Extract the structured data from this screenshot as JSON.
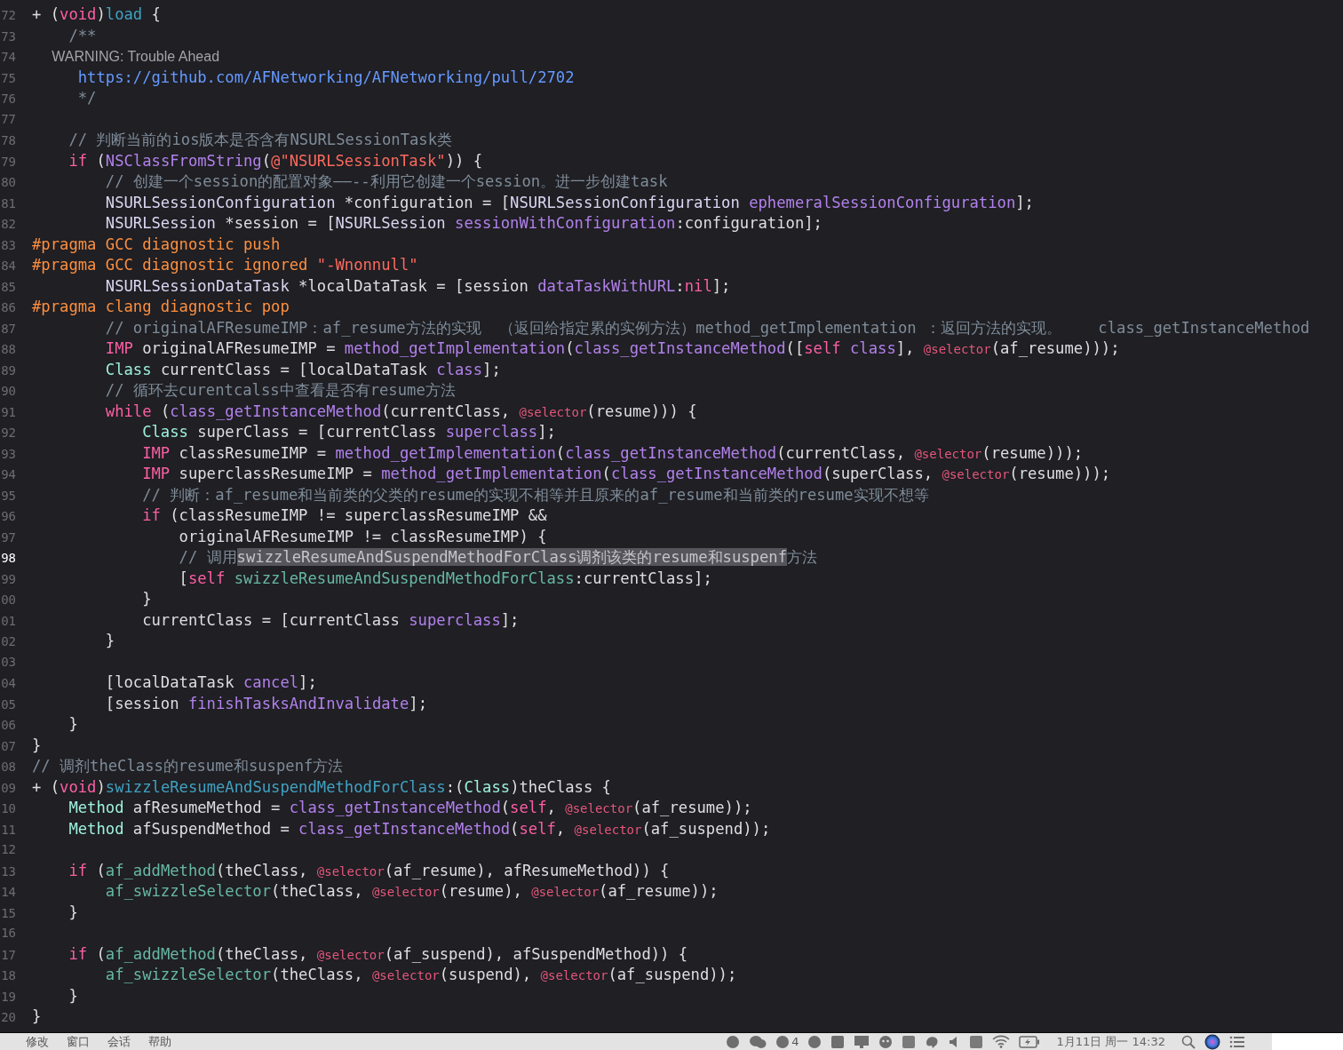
{
  "editor": {
    "lines": [
      {
        "number": "72",
        "current": false,
        "tokens": [
          {
            "kind": "plain",
            "text": "+ ("
          },
          {
            "kind": "keyword",
            "text": "void"
          },
          {
            "kind": "plain",
            "text": ")"
          },
          {
            "kind": "decl",
            "text": "load"
          },
          {
            "kind": "plain",
            "text": " {"
          }
        ]
      },
      {
        "number": "73",
        "current": false,
        "tokens": [
          {
            "kind": "comment",
            "text": "    /**"
          }
        ]
      },
      {
        "number": "74",
        "current": false,
        "tokens": [
          {
            "kind": "doc",
            "text": "     WARNING: Trouble Ahead"
          }
        ]
      },
      {
        "number": "75",
        "current": false,
        "tokens": [
          {
            "kind": "url",
            "text": "     https://github.com/AFNetworking/AFNetworking/pull/2702"
          }
        ]
      },
      {
        "number": "76",
        "current": false,
        "tokens": [
          {
            "kind": "comment",
            "text": "     */"
          }
        ]
      },
      {
        "number": "77",
        "current": false
      },
      {
        "number": "78",
        "current": false,
        "tokens": [
          {
            "kind": "comment",
            "text": "    // 判断当前的ios版本是否含有NSURLSessionTask类"
          }
        ]
      },
      {
        "number": "79",
        "current": false,
        "tokens": [
          {
            "kind": "keyword",
            "text": "    if"
          },
          {
            "kind": "plain",
            "text": " ("
          },
          {
            "kind": "lib",
            "text": "NSClassFromString"
          },
          {
            "kind": "plain",
            "text": "("
          },
          {
            "kind": "string",
            "text": "@\"NSURLSessionTask\""
          },
          {
            "kind": "plain",
            "text": ")) {"
          }
        ]
      },
      {
        "number": "80",
        "current": false,
        "tokens": [
          {
            "kind": "comment",
            "text": "        // 创建一个session的配置对象——--利用它创建一个session。进一步创建task"
          }
        ]
      },
      {
        "number": "81",
        "current": false,
        "tokens": [
          {
            "kind": "class",
            "text": "        NSURLSessionConfiguration"
          },
          {
            "kind": "plain",
            "text": " *configuration = ["
          },
          {
            "kind": "class",
            "text": "NSURLSessionConfiguration "
          },
          {
            "kind": "lib",
            "text": "ephemeralSessionConfiguration"
          },
          {
            "kind": "plain",
            "text": "];"
          }
        ]
      },
      {
        "number": "82",
        "current": false,
        "tokens": [
          {
            "kind": "class",
            "text": "        NSURLSession"
          },
          {
            "kind": "plain",
            "text": " *session = ["
          },
          {
            "kind": "class",
            "text": "NSURLSession "
          },
          {
            "kind": "lib",
            "text": "sessionWithConfiguration"
          },
          {
            "kind": "plain",
            "text": ":configuration];"
          }
        ]
      },
      {
        "number": "83",
        "current": false,
        "tokens": [
          {
            "kind": "preproc",
            "text": "#pragma GCC diagnostic push"
          }
        ]
      },
      {
        "number": "84",
        "current": false,
        "tokens": [
          {
            "kind": "preproc",
            "text": "#pragma GCC diagnostic ignored "
          },
          {
            "kind": "string",
            "text": "\"-Wnonnull\""
          }
        ]
      },
      {
        "number": "85",
        "current": false,
        "tokens": [
          {
            "kind": "class",
            "text": "        NSURLSessionDataTask"
          },
          {
            "kind": "plain",
            "text": " *localDataTask = [session "
          },
          {
            "kind": "lib",
            "text": "dataTaskWithURL"
          },
          {
            "kind": "plain",
            "text": ":"
          },
          {
            "kind": "keyword",
            "text": "nil"
          },
          {
            "kind": "plain",
            "text": "];"
          }
        ]
      },
      {
        "number": "86",
        "current": false,
        "tokens": [
          {
            "kind": "preproc",
            "text": "#pragma clang diagnostic pop"
          }
        ]
      },
      {
        "number": "87",
        "current": false,
        "tokens": [
          {
            "kind": "comment",
            "text": "        // originalAFResumeIMP：af_resume方法的实现  （返回给指定累的实例方法）method_getImplementation ：返回方法的实现。    class_getInstanceMethod"
          }
        ]
      },
      {
        "number": "88",
        "current": false,
        "tokens": [
          {
            "kind": "keyword",
            "text": "        IMP"
          },
          {
            "kind": "plain",
            "text": " originalAFResumeIMP = "
          },
          {
            "kind": "lib",
            "text": "method_getImplementation"
          },
          {
            "kind": "plain",
            "text": "("
          },
          {
            "kind": "lib",
            "text": "class_getInstanceMethod"
          },
          {
            "kind": "plain",
            "text": "(["
          },
          {
            "kind": "keyword",
            "text": "self "
          },
          {
            "kind": "lib",
            "text": "class"
          },
          {
            "kind": "plain",
            "text": "], "
          },
          {
            "kind": "at",
            "text": "@selector"
          },
          {
            "kind": "plain",
            "text": "(af_resume)));"
          }
        ]
      },
      {
        "number": "89",
        "current": false,
        "tokens": [
          {
            "kind": "type",
            "text": "        Class"
          },
          {
            "kind": "plain",
            "text": " currentClass = [localDataTask "
          },
          {
            "kind": "lib",
            "text": "class"
          },
          {
            "kind": "plain",
            "text": "];"
          }
        ]
      },
      {
        "number": "90",
        "current": false,
        "tokens": [
          {
            "kind": "comment",
            "text": "        // 循环去curentcalss中查看是否有resume方法"
          }
        ]
      },
      {
        "number": "91",
        "current": false,
        "tokens": [
          {
            "kind": "keyword",
            "text": "        while"
          },
          {
            "kind": "plain",
            "text": " ("
          },
          {
            "kind": "lib",
            "text": "class_getInstanceMethod"
          },
          {
            "kind": "plain",
            "text": "(currentClass, "
          },
          {
            "kind": "at",
            "text": "@selector"
          },
          {
            "kind": "plain",
            "text": "(resume))) {"
          }
        ]
      },
      {
        "number": "92",
        "current": false,
        "tokens": [
          {
            "kind": "type",
            "text": "            Class"
          },
          {
            "kind": "plain",
            "text": " superClass = [currentClass "
          },
          {
            "kind": "lib",
            "text": "superclass"
          },
          {
            "kind": "plain",
            "text": "];"
          }
        ]
      },
      {
        "number": "93",
        "current": false,
        "tokens": [
          {
            "kind": "keyword",
            "text": "            IMP"
          },
          {
            "kind": "plain",
            "text": " classResumeIMP = "
          },
          {
            "kind": "lib",
            "text": "method_getImplementation"
          },
          {
            "kind": "plain",
            "text": "("
          },
          {
            "kind": "lib",
            "text": "class_getInstanceMethod"
          },
          {
            "kind": "plain",
            "text": "(currentClass, "
          },
          {
            "kind": "at",
            "text": "@selector"
          },
          {
            "kind": "plain",
            "text": "(resume)));"
          }
        ]
      },
      {
        "number": "94",
        "current": false,
        "tokens": [
          {
            "kind": "keyword",
            "text": "            IMP"
          },
          {
            "kind": "plain",
            "text": " superclassResumeIMP = "
          },
          {
            "kind": "lib",
            "text": "method_getImplementation"
          },
          {
            "kind": "plain",
            "text": "("
          },
          {
            "kind": "lib",
            "text": "class_getInstanceMethod"
          },
          {
            "kind": "plain",
            "text": "(superClass, "
          },
          {
            "kind": "at",
            "text": "@selector"
          },
          {
            "kind": "plain",
            "text": "(resume)));"
          }
        ]
      },
      {
        "number": "95",
        "current": false,
        "tokens": [
          {
            "kind": "comment",
            "text": "            // 判断：af_resume和当前类的父类的resume的实现不相等并且原来的af_resume和当前类的resume实现不想等"
          }
        ]
      },
      {
        "number": "96",
        "current": false,
        "tokens": [
          {
            "kind": "keyword",
            "text": "            if"
          },
          {
            "kind": "plain",
            "text": " (classResumeIMP != superclassResumeIMP &&"
          }
        ]
      },
      {
        "number": "97",
        "current": false,
        "tokens": [
          {
            "kind": "plain",
            "text": "                originalAFResumeIMP != classResumeIMP) {"
          }
        ]
      },
      {
        "number": "98",
        "current": true,
        "tokens": [
          {
            "kind": "comment",
            "text": "                // 调用"
          },
          {
            "kind": "comment-selected",
            "text": "swizzleResumeAndSuspendMethodForClass调剂该类的resume和suspenf"
          },
          {
            "kind": "comment",
            "text": "方法"
          }
        ]
      },
      {
        "number": "99",
        "current": false,
        "tokens": [
          {
            "kind": "plain",
            "text": "                ["
          },
          {
            "kind": "keyword",
            "text": "self "
          },
          {
            "kind": "project",
            "text": "swizzleResumeAndSuspendMethodForClass"
          },
          {
            "kind": "plain",
            "text": ":currentClass];"
          }
        ]
      },
      {
        "number": "00",
        "current": false,
        "tokens": [
          {
            "kind": "plain",
            "text": "            }"
          }
        ]
      },
      {
        "number": "01",
        "current": false,
        "tokens": [
          {
            "kind": "plain",
            "text": "            currentClass = [currentClass "
          },
          {
            "kind": "lib",
            "text": "superclass"
          },
          {
            "kind": "plain",
            "text": "];"
          }
        ]
      },
      {
        "number": "02",
        "current": false,
        "tokens": [
          {
            "kind": "plain",
            "text": "        }"
          }
        ]
      },
      {
        "number": "03",
        "current": false
      },
      {
        "number": "04",
        "current": false,
        "tokens": [
          {
            "kind": "plain",
            "text": "        [localDataTask "
          },
          {
            "kind": "lib",
            "text": "cancel"
          },
          {
            "kind": "plain",
            "text": "];"
          }
        ]
      },
      {
        "number": "05",
        "current": false,
        "tokens": [
          {
            "kind": "plain",
            "text": "        [session "
          },
          {
            "kind": "lib",
            "text": "finishTasksAndInvalidate"
          },
          {
            "kind": "plain",
            "text": "];"
          }
        ]
      },
      {
        "number": "06",
        "current": false,
        "tokens": [
          {
            "kind": "plain",
            "text": "    }"
          }
        ]
      },
      {
        "number": "07",
        "current": false,
        "tokens": [
          {
            "kind": "plain",
            "text": "}"
          }
        ]
      },
      {
        "number": "08",
        "current": false,
        "tokens": [
          {
            "kind": "comment",
            "text": "// 调剂theClass的resume和suspenf方法"
          }
        ]
      },
      {
        "number": "09",
        "current": false,
        "tokens": [
          {
            "kind": "plain",
            "text": "+ ("
          },
          {
            "kind": "keyword",
            "text": "void"
          },
          {
            "kind": "plain",
            "text": ")"
          },
          {
            "kind": "decl",
            "text": "swizzleResumeAndSuspendMethodForClass"
          },
          {
            "kind": "plain",
            "text": ":("
          },
          {
            "kind": "type",
            "text": "Class"
          },
          {
            "kind": "plain",
            "text": ")theClass {"
          }
        ]
      },
      {
        "number": "10",
        "current": false,
        "tokens": [
          {
            "kind": "type",
            "text": "    Method"
          },
          {
            "kind": "plain",
            "text": " afResumeMethod = "
          },
          {
            "kind": "lib",
            "text": "class_getInstanceMethod"
          },
          {
            "kind": "plain",
            "text": "("
          },
          {
            "kind": "keyword",
            "text": "self"
          },
          {
            "kind": "plain",
            "text": ", "
          },
          {
            "kind": "at",
            "text": "@selector"
          },
          {
            "kind": "plain",
            "text": "(af_resume));"
          }
        ]
      },
      {
        "number": "11",
        "current": false,
        "tokens": [
          {
            "kind": "type",
            "text": "    Method"
          },
          {
            "kind": "plain",
            "text": " afSuspendMethod = "
          },
          {
            "kind": "lib",
            "text": "class_getInstanceMethod"
          },
          {
            "kind": "plain",
            "text": "("
          },
          {
            "kind": "keyword",
            "text": "self"
          },
          {
            "kind": "plain",
            "text": ", "
          },
          {
            "kind": "at",
            "text": "@selector"
          },
          {
            "kind": "plain",
            "text": "(af_suspend));"
          }
        ]
      },
      {
        "number": "12",
        "current": false
      },
      {
        "number": "13",
        "current": false,
        "tokens": [
          {
            "kind": "keyword",
            "text": "    if"
          },
          {
            "kind": "plain",
            "text": " ("
          },
          {
            "kind": "project",
            "text": "af_addMethod"
          },
          {
            "kind": "plain",
            "text": "(theClass, "
          },
          {
            "kind": "at",
            "text": "@selector"
          },
          {
            "kind": "plain",
            "text": "(af_resume), afResumeMethod)) {"
          }
        ]
      },
      {
        "number": "14",
        "current": false,
        "tokens": [
          {
            "kind": "project",
            "text": "        af_swizzleSelector"
          },
          {
            "kind": "plain",
            "text": "(theClass, "
          },
          {
            "kind": "at",
            "text": "@selector"
          },
          {
            "kind": "plain",
            "text": "(resume), "
          },
          {
            "kind": "at",
            "text": "@selector"
          },
          {
            "kind": "plain",
            "text": "(af_resume));"
          }
        ]
      },
      {
        "number": "15",
        "current": false,
        "tokens": [
          {
            "kind": "plain",
            "text": "    }"
          }
        ]
      },
      {
        "number": "16",
        "current": false
      },
      {
        "number": "17",
        "current": false,
        "tokens": [
          {
            "kind": "keyword",
            "text": "    if"
          },
          {
            "kind": "plain",
            "text": " ("
          },
          {
            "kind": "project",
            "text": "af_addMethod"
          },
          {
            "kind": "plain",
            "text": "(theClass, "
          },
          {
            "kind": "at",
            "text": "@selector"
          },
          {
            "kind": "plain",
            "text": "(af_suspend), afSuspendMethod)) {"
          }
        ]
      },
      {
        "number": "18",
        "current": false,
        "tokens": [
          {
            "kind": "project",
            "text": "        af_swizzleSelector"
          },
          {
            "kind": "plain",
            "text": "(theClass, "
          },
          {
            "kind": "at",
            "text": "@selector"
          },
          {
            "kind": "plain",
            "text": "(suspend), "
          },
          {
            "kind": "at",
            "text": "@selector"
          },
          {
            "kind": "plain",
            "text": "(af_suspend));"
          }
        ]
      },
      {
        "number": "19",
        "current": false,
        "tokens": [
          {
            "kind": "plain",
            "text": "    }"
          }
        ]
      },
      {
        "number": "20",
        "current": false,
        "tokens": [
          {
            "kind": "plain",
            "text": "}"
          }
        ]
      }
    ]
  },
  "menu_bar": {
    "menus": [
      "修改",
      "窗口",
      "会话",
      "帮助"
    ],
    "badge_count": "4",
    "clock": "1月11日 周一 14:32"
  }
}
